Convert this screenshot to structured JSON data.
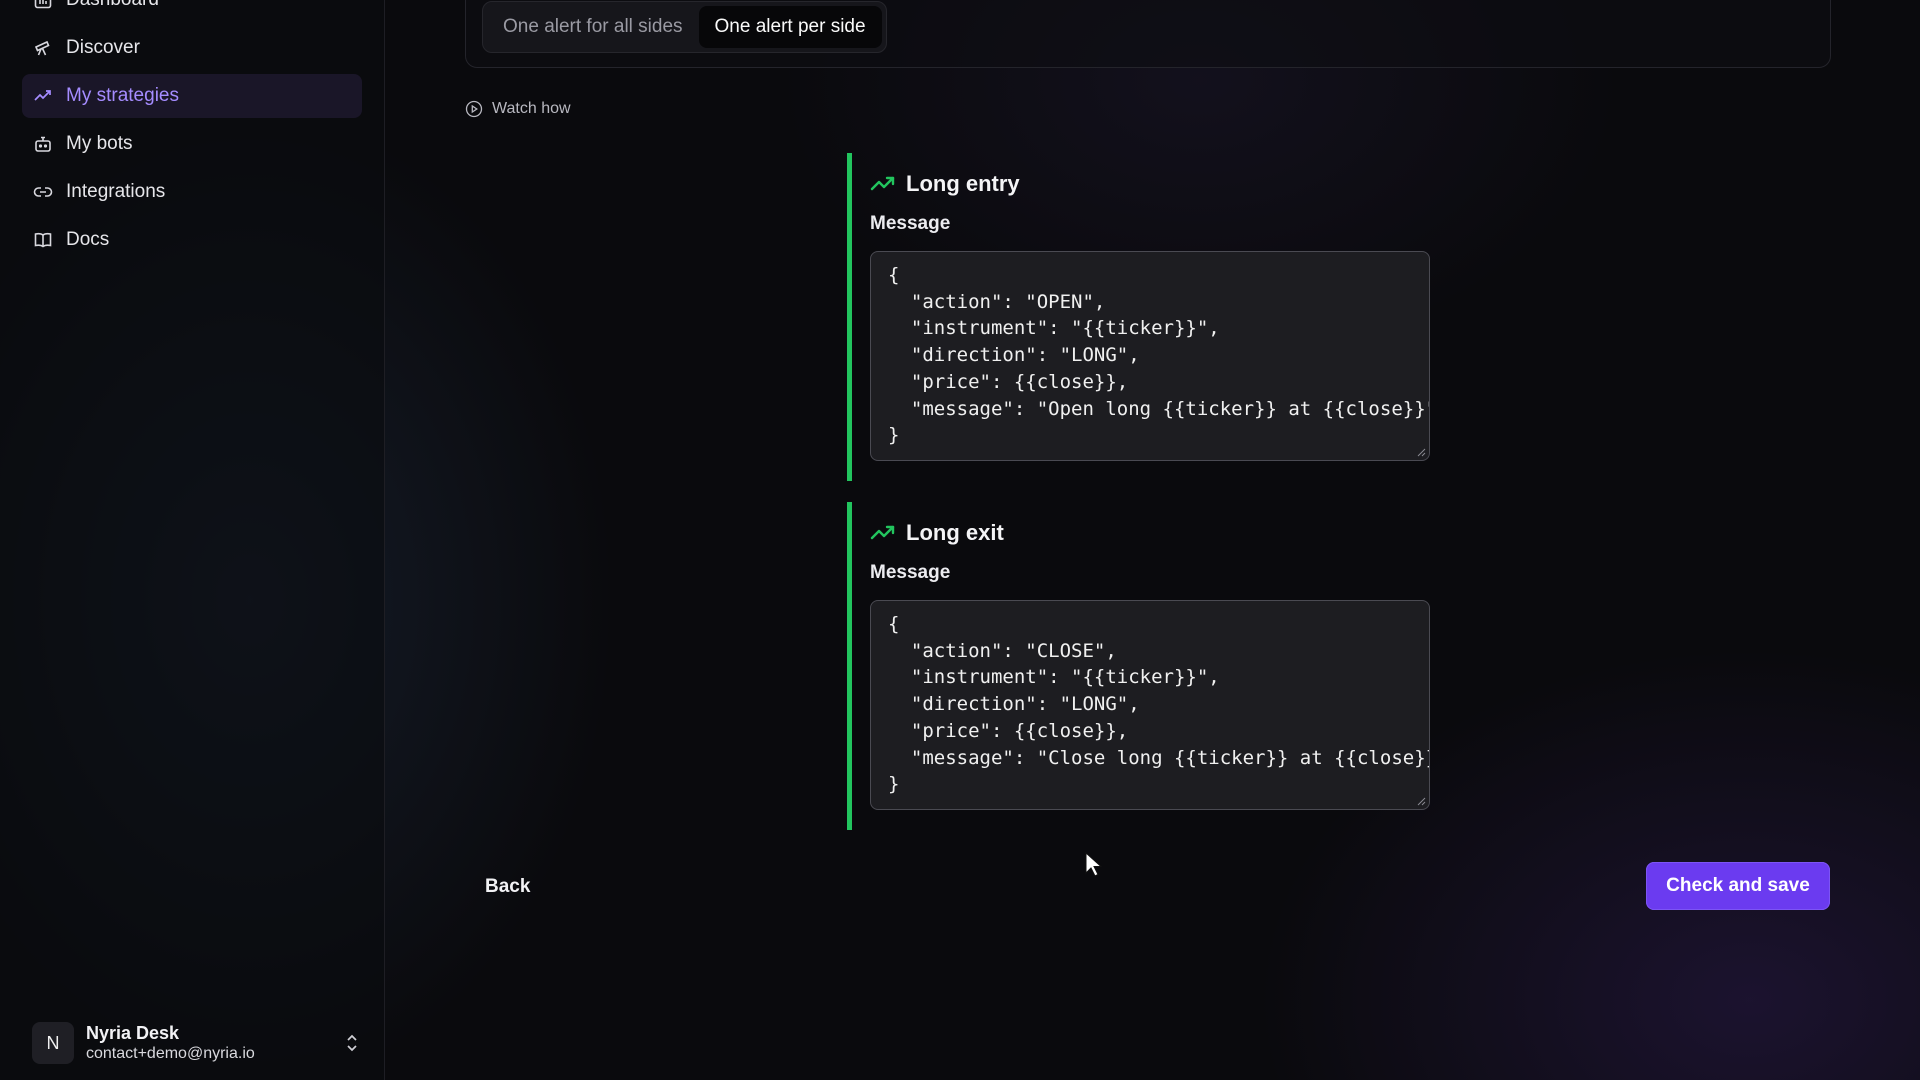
{
  "sidebar": {
    "items": [
      {
        "label": "Dashboard",
        "icon": "bar-chart-icon",
        "active": false
      },
      {
        "label": "Discover",
        "icon": "telescope-icon",
        "active": false
      },
      {
        "label": "My strategies",
        "icon": "trending-up-icon",
        "active": true
      },
      {
        "label": "My bots",
        "icon": "bot-icon",
        "active": false
      },
      {
        "label": "Integrations",
        "icon": "link-icon",
        "active": false
      },
      {
        "label": "Docs",
        "icon": "book-icon",
        "active": false
      }
    ],
    "user": {
      "initial": "N",
      "name": "Nyria Desk",
      "email": "contact+demo@nyria.io"
    }
  },
  "alert_mode": {
    "options": [
      "One alert for all sides",
      "One alert per side"
    ],
    "selected": "One alert per side"
  },
  "watch_how": "Watch how",
  "blocks": [
    {
      "title": "Long entry",
      "message_label": "Message",
      "message": "{\n  \"action\": \"OPEN\",\n  \"instrument\": \"{{ticker}}\",\n  \"direction\": \"LONG\",\n  \"price\": {{close}},\n  \"message\": \"Open long {{ticker}} at {{close}}\"\n}"
    },
    {
      "title": "Long exit",
      "message_label": "Message",
      "message": "{\n  \"action\": \"CLOSE\",\n  \"instrument\": \"{{ticker}}\",\n  \"direction\": \"LONG\",\n  \"price\": {{close}},\n  \"message\": \"Close long {{ticker}} at {{close}}\n}"
    }
  ],
  "actions": {
    "back": "Back",
    "save": "Check and save"
  },
  "colors": {
    "accent": "#6b3bf0",
    "active_nav": "#a58cff",
    "side_bar": "#22c55e"
  }
}
